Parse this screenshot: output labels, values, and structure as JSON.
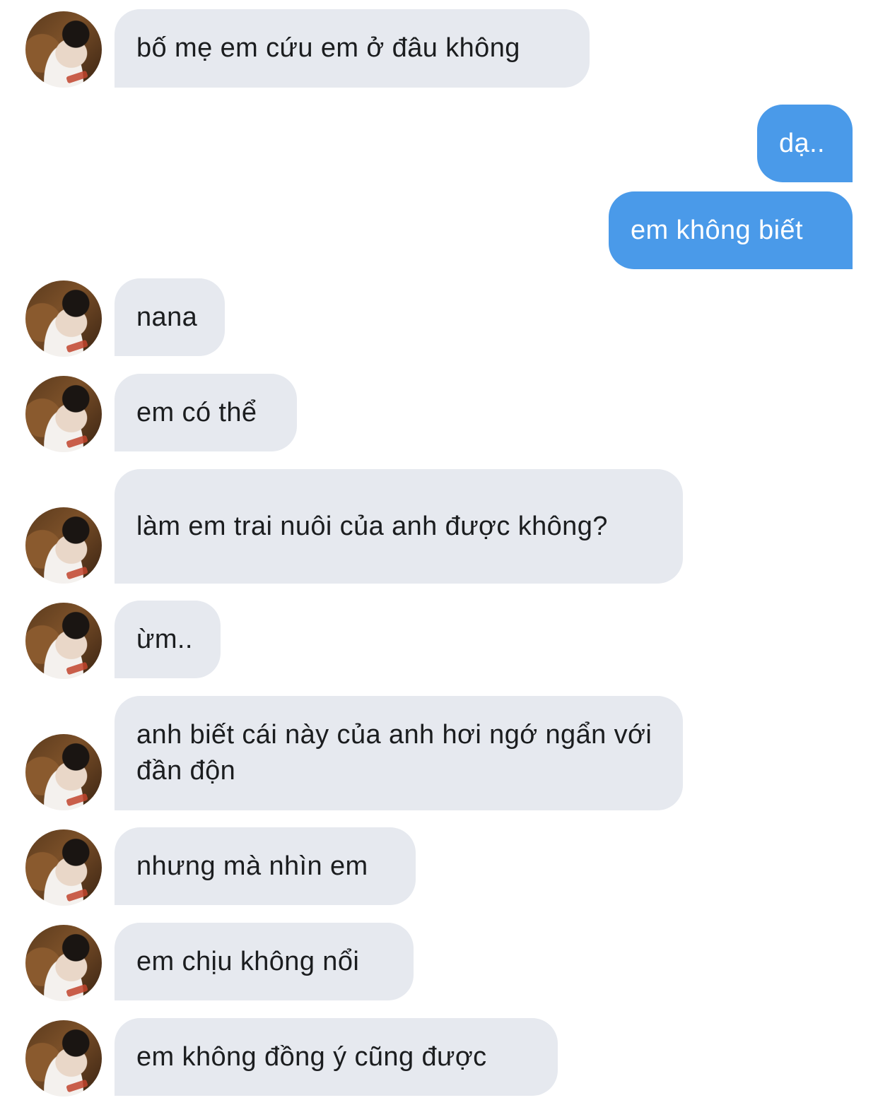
{
  "conversation": {
    "messages": [
      {
        "direction": "incoming",
        "text": "bố mẹ em cứu em ở đâu không"
      },
      {
        "direction": "outgoing",
        "text": "dạ.."
      },
      {
        "direction": "outgoing",
        "text": "em không biết"
      },
      {
        "direction": "incoming",
        "text": "nana"
      },
      {
        "direction": "incoming",
        "text": "em có thể"
      },
      {
        "direction": "incoming",
        "text": "làm em trai nuôi của anh được không?"
      },
      {
        "direction": "incoming",
        "text": "ừm.."
      },
      {
        "direction": "incoming",
        "text": "anh biết cái này của anh hơi ngớ ngẩn với đần độn"
      },
      {
        "direction": "incoming",
        "text": "nhưng mà nhìn em"
      },
      {
        "direction": "incoming",
        "text": "em chịu không nổi"
      },
      {
        "direction": "incoming",
        "text": "em không đồng ý cũng được"
      }
    ]
  },
  "colors": {
    "incoming_bubble": "#e6e9ef",
    "incoming_text": "#1b1d1f",
    "outgoing_bubble": "#4a9ae9",
    "outgoing_text": "#ffffff",
    "background": "#ffffff"
  }
}
